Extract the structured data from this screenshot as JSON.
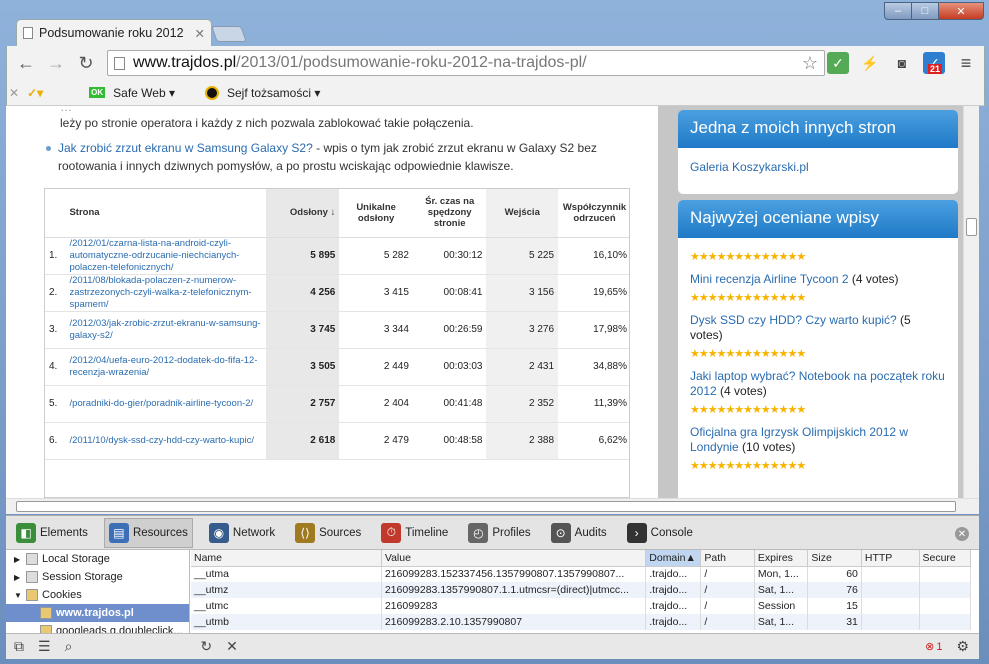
{
  "window": {
    "tab_title": "Podsumowanie roku 2012",
    "min": "–",
    "max": "□",
    "close": "✕"
  },
  "toolbar": {
    "back": "←",
    "forward": "→",
    "reload": "↻",
    "url_host": "www.trajdos.pl",
    "url_path": "/2013/01/podsumowanie-roku-2012-na-trajdos-pl/",
    "badge": "21"
  },
  "bookmarks": {
    "safe_web": "Safe Web",
    "identity": "Sejf tożsamości"
  },
  "page": {
    "para1": "leży po stronie operatora i każdy z nich pozwala zablokować takie połączenia.",
    "link2": "Jak zrobić zrzut ekranu w Samsung Galaxy S2?",
    "para2a": " - wpis o tym jak zrobić zrzut ekranu w Galaxy S2 bez",
    "para2b": "rootowania i innych dziwnych pomysłów, a po prostu wciskając odpowiednie klawisze.",
    "table": {
      "headers": [
        "Strona",
        "Odsłony",
        "Unikalne odsłony",
        "Śr. czas na spędzony stronie",
        "Wejścia",
        "Współczynnik odrzuceń"
      ],
      "rows": [
        [
          "1.",
          "/2012/01/czarna-lista-na-android-czyli-automatyczne-odrzucanie-niechcianych-polaczen-telefonicznych/",
          "5 895",
          "5 282",
          "00:30:12",
          "5 225",
          "16,10%"
        ],
        [
          "2.",
          "/2011/08/blokada-polaczen-z-numerow-zastrzezonych-czyli-walka-z-telefonicznym-spamem/",
          "4 256",
          "3 415",
          "00:08:41",
          "3 156",
          "19,65%"
        ],
        [
          "3.",
          "/2012/03/jak-zrobic-zrzut-ekranu-w-samsung-galaxy-s2/",
          "3 745",
          "3 344",
          "00:26:59",
          "3 276",
          "17,98%"
        ],
        [
          "4.",
          "/2012/04/uefa-euro-2012-dodatek-do-fifa-12-recenzja-wrazenia/",
          "3 505",
          "2 449",
          "00:03:03",
          "2 431",
          "34,88%"
        ],
        [
          "5.",
          "/poradniki-do-gier/poradnik-airline-tycoon-2/",
          "2 757",
          "2 404",
          "00:41:48",
          "2 352",
          "11,39%"
        ],
        [
          "6.",
          "/2011/10/dysk-ssd-czy-hdd-czy-warto-kupic/",
          "2 618",
          "2 479",
          "00:48:58",
          "2 388",
          "6,62%"
        ]
      ]
    }
  },
  "sidebar": {
    "w1_title": "Jedna z moich innych stron",
    "w1_link": "Galeria Koszykarski.pl",
    "w2_title": "Najwyżej oceniane wpisy",
    "stars": "★★★★★★★★★★★★★",
    "items": [
      {
        "title": "Mini recenzja Airline Tycoon 2",
        "votes": " (4 votes)"
      },
      {
        "title": "Dysk SSD czy HDD? Czy warto kupić?",
        "votes": " (5 votes)"
      },
      {
        "title": "Jaki laptop wybrać? Notebook na początek roku 2012",
        "votes": " (4 votes)"
      },
      {
        "title": "Oficjalna gra Igrzysk Olimpijskich 2012 w Londynie",
        "votes": " (10 votes)"
      }
    ]
  },
  "devtools": {
    "tabs": [
      "Elements",
      "Resources",
      "Network",
      "Sources",
      "Timeline",
      "Profiles",
      "Audits",
      "Console"
    ],
    "tab_colors": [
      "#3b8f3b",
      "#3d6fb6",
      "#355c8c",
      "#a07a20",
      "#c0392b",
      "#666",
      "#555",
      "#333"
    ],
    "tree": [
      "Local Storage",
      "Session Storage",
      "Cookies",
      "www.trajdos.pl",
      "googleads.g.doubleclick..."
    ],
    "columns": [
      "Name",
      "Value",
      "Domain▲",
      "Path",
      "Expires",
      "Size",
      "HTTP",
      "Secure"
    ],
    "cookies": [
      [
        "__utma",
        "216099283.152337456.1357990807.1357990807...",
        ".trajdo...",
        "/",
        "Mon, 1...",
        "60",
        "",
        ""
      ],
      [
        "__utmz",
        "216099283.1357990807.1.1.utmcsr=(direct)|utmcc...",
        ".trajdo...",
        "/",
        "Sat, 1...",
        "76",
        "",
        ""
      ],
      [
        "__utmc",
        "216099283",
        ".trajdo...",
        "/",
        "Session",
        "15",
        "",
        ""
      ],
      [
        "__utmb",
        "216099283.2.10.1357990807",
        ".trajdo...",
        "/",
        "Sat, 1...",
        "31",
        "",
        ""
      ]
    ],
    "errors": "1"
  }
}
